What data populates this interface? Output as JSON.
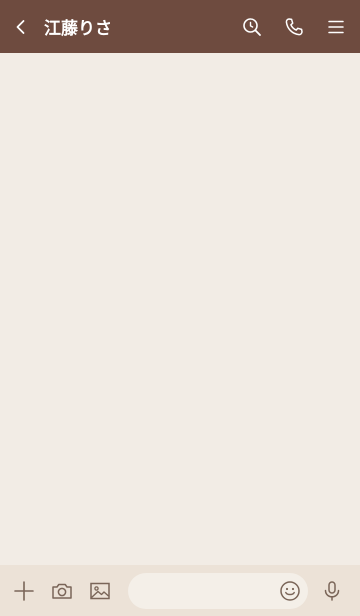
{
  "header": {
    "title": "江藤りさ",
    "icons": [
      "chevron-left-icon",
      "search-icon",
      "phone-icon",
      "menu-icon"
    ]
  },
  "footer": {
    "message_placeholder": "",
    "icons": [
      "plus-icon",
      "camera-icon",
      "image-icon",
      "smiley-icon",
      "microphone-icon"
    ]
  },
  "colors": {
    "header_bg": "#6e4b3f",
    "background": "#f2ece5",
    "footer_bg": "#ece2d7",
    "header_icon": "#ffffff",
    "footer_icon": "#7a6558"
  }
}
